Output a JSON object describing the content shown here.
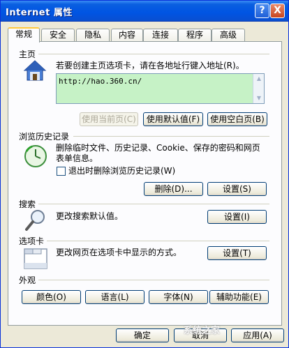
{
  "window": {
    "title": "Internet 属性"
  },
  "titlebar": {
    "help": "?",
    "close": "X"
  },
  "tabs": [
    "常规",
    "安全",
    "隐私",
    "内容",
    "连接",
    "程序",
    "高级"
  ],
  "home": {
    "label": "主页",
    "desc": "若要创建主页选项卡，请在各地址行键入地址(R)。",
    "url": "http://hao.360.cn/",
    "use_current": "使用当前页(C)",
    "use_default": "使用默认值(F)",
    "use_blank": "使用空白页(B)"
  },
  "history": {
    "label": "浏览历史记录",
    "desc_line1": "删除临时文件、历史记录、Cookie、保存的密码和网页",
    "desc_line2": "表单信息。",
    "checkbox": "退出时删除浏览历史记录(W)",
    "delete": "删除(D)...",
    "settings": "设置(S)"
  },
  "search": {
    "label": "搜索",
    "desc": "更改搜索默认值。",
    "settings": "设置(I)"
  },
  "tabsec": {
    "label": "选项卡",
    "desc": "更改网页在选项卡中显示的方式。",
    "settings": "设置(T)"
  },
  "appearance": {
    "label": "外观",
    "colors": "颜色(O)",
    "languages": "语言(L)",
    "fonts": "字体(N)",
    "accessibility": "辅助功能(E)"
  },
  "footer": {
    "ok": "确定",
    "cancel": "取消",
    "apply": "应用(A)"
  },
  "watermark": "系统之家"
}
